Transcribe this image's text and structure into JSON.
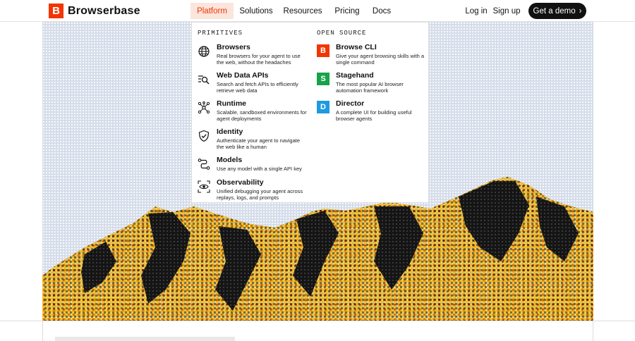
{
  "brand": {
    "name": "Browserbase",
    "logo_letter": "B",
    "color": "#f03603"
  },
  "nav": {
    "items": [
      "Platform",
      "Solutions",
      "Resources",
      "Pricing",
      "Docs"
    ],
    "active": "Platform"
  },
  "actions": {
    "login": "Log in",
    "signup": "Sign up",
    "demo": "Get a demo",
    "demo_arrow": "›"
  },
  "dropdown": {
    "primitives_title": "PRIMITIVES",
    "open_source_title": "OPEN SOURCE",
    "primitives": [
      {
        "title": "Browsers",
        "desc": "Real browsers for your agent to use the web, without the headaches",
        "icon": "globe-icon"
      },
      {
        "title": "Web Data APIs",
        "desc": "Search and fetch APIs to efficiently retrieve web data",
        "icon": "search-document-icon"
      },
      {
        "title": "Runtime",
        "desc": "Scalable, sandboxed environments for agent deployments",
        "icon": "network-nodes-icon"
      },
      {
        "title": "Identity",
        "desc": "Authenticate your agent to navigate the web like a human",
        "icon": "shield-check-icon"
      },
      {
        "title": "Models",
        "desc": "Use any model with a single API key",
        "icon": "route-icon"
      },
      {
        "title": "Observability",
        "desc": "Unified debugging your agent across replays, logs, and prompts",
        "icon": "eye-icon"
      }
    ],
    "open_source": [
      {
        "title": "Browse CLI",
        "desc": "Give your agent browsing skills with a single command",
        "icon": "browse-cli-icon",
        "letter": "B",
        "color": "#f03603"
      },
      {
        "title": "Stagehand",
        "desc": "The most popular AI browser automation framework",
        "icon": "stagehand-icon",
        "letter": "S",
        "color": "#17a34a"
      },
      {
        "title": "Director",
        "desc": "A complete UI for building useful browser agents",
        "icon": "director-icon",
        "letter": "D",
        "color": "#1d9be0"
      }
    ]
  }
}
